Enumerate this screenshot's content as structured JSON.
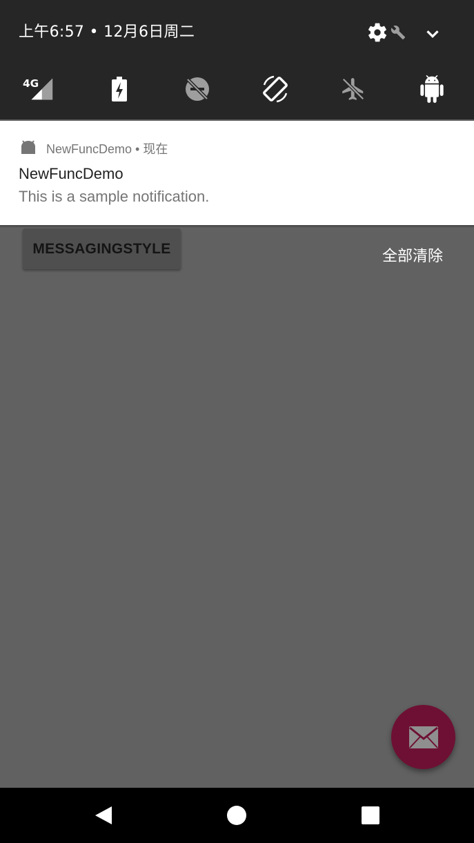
{
  "status": {
    "datetime": "上午6:57 • 12月6日周二"
  },
  "quick_settings": {
    "header_icons": [
      "settings-icon",
      "wrench-icon",
      "expand-chevron-icon"
    ],
    "tiles": [
      {
        "name": "cellular-4g-icon",
        "label": "4G"
      },
      {
        "name": "battery-saver-icon"
      },
      {
        "name": "do-not-disturb-off-icon"
      },
      {
        "name": "auto-rotate-icon"
      },
      {
        "name": "airplane-mode-off-icon"
      },
      {
        "name": "android-icon"
      }
    ]
  },
  "notification": {
    "app_name": "NewFuncDemo",
    "time": "现在",
    "header": "NewFuncDemo • 现在",
    "title": "NewFuncDemo",
    "text": "This is a sample notification."
  },
  "shade": {
    "clear_all_label": "全部清除"
  },
  "app": {
    "button_label": "MESSAGINGSTYLE",
    "fab_icon": "mail-icon",
    "fab_color": "#6e1033"
  },
  "navbar": {
    "icons": [
      "back-icon",
      "home-icon",
      "recents-icon"
    ]
  },
  "colors": {
    "qs_background": "#262626",
    "scrim": "#616161",
    "notification_background": "#ffffff"
  }
}
